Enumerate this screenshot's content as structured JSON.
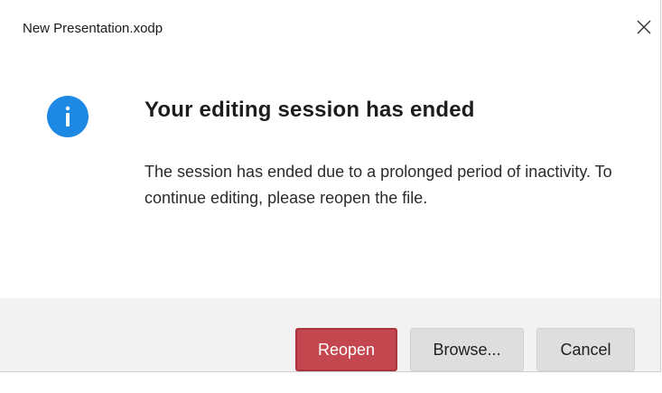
{
  "window": {
    "title": "New Presentation.xodp"
  },
  "dialog": {
    "icon": "info-icon",
    "heading": "Your editing session has ended",
    "message": "The session has ended due to a prolonged period of inactivity. To continue editing, please reopen the file."
  },
  "buttons": {
    "reopen_label": "Reopen",
    "browse_label": "Browse...",
    "cancel_label": "Cancel"
  },
  "colors": {
    "info_icon": "#1e88e5",
    "primary_button": "#c4464e",
    "secondary_button": "#dedede",
    "footer_background": "#f2f2f2"
  }
}
